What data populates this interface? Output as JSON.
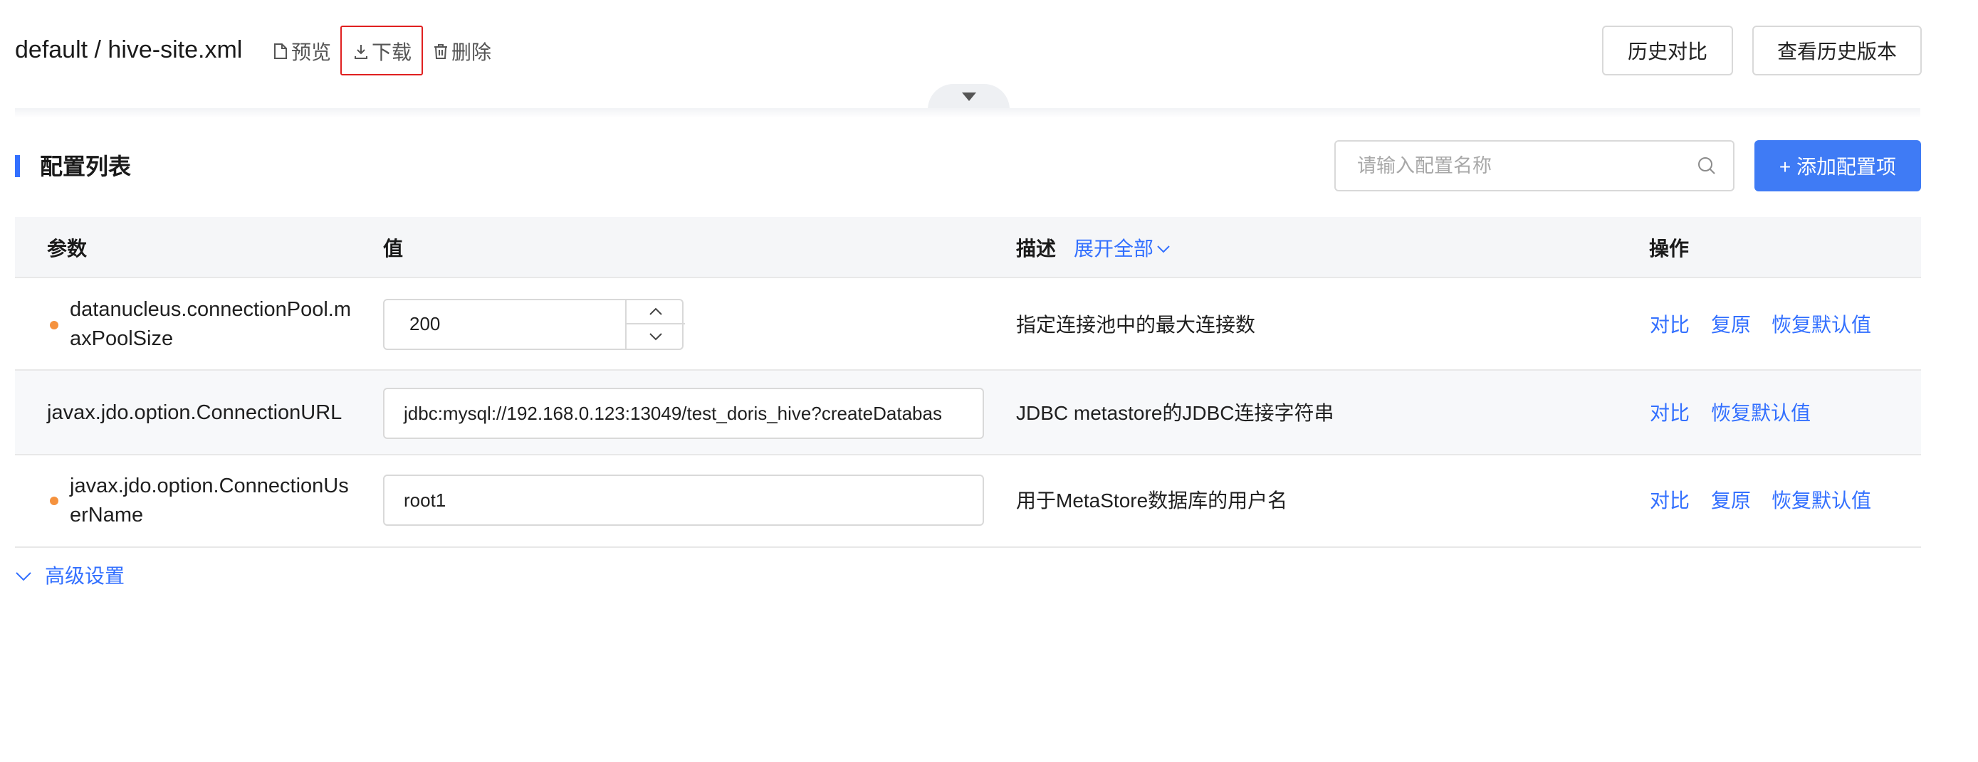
{
  "header": {
    "title": "default / hive-site.xml",
    "preview_label": "预览",
    "download_label": "下载",
    "delete_label": "删除",
    "history_compare_label": "历史对比",
    "history_versions_label": "查看历史版本"
  },
  "section": {
    "title": "配置列表",
    "search_placeholder": "请输入配置名称",
    "add_button": "+ 添加配置项"
  },
  "table": {
    "columns": {
      "param": "参数",
      "value": "值",
      "desc": "描述",
      "expand_all": "展开全部",
      "ops": "操作"
    },
    "rows": [
      {
        "param_line1": "datanucleus.connectionPool.m",
        "param_line2": "axPoolSize",
        "value": "200",
        "desc": "指定连接池中的最大连接数",
        "op_compare": "对比",
        "op_restore": "复原",
        "op_default": "恢复默认值"
      },
      {
        "param": "javax.jdo.option.ConnectionURL",
        "value": "jdbc:mysql://192.168.0.123:13049/test_doris_hive?createDatabas",
        "desc": "JDBC metastore的JDBC连接字符串",
        "op_compare": "对比",
        "op_default": "恢复默认值"
      },
      {
        "param_line1": "javax.jdo.option.ConnectionUs",
        "param_line2": "erName",
        "value": "root1",
        "desc": "用于MetaStore数据库的用户名",
        "op_compare": "对比",
        "op_restore": "复原",
        "op_default": "恢复默认值"
      }
    ]
  },
  "advanced": {
    "label": "高级设置"
  },
  "colors": {
    "primary": "#3f7bf5",
    "link": "#3370ff",
    "modified_dot": "#f5923e",
    "highlight": "#e02020"
  }
}
